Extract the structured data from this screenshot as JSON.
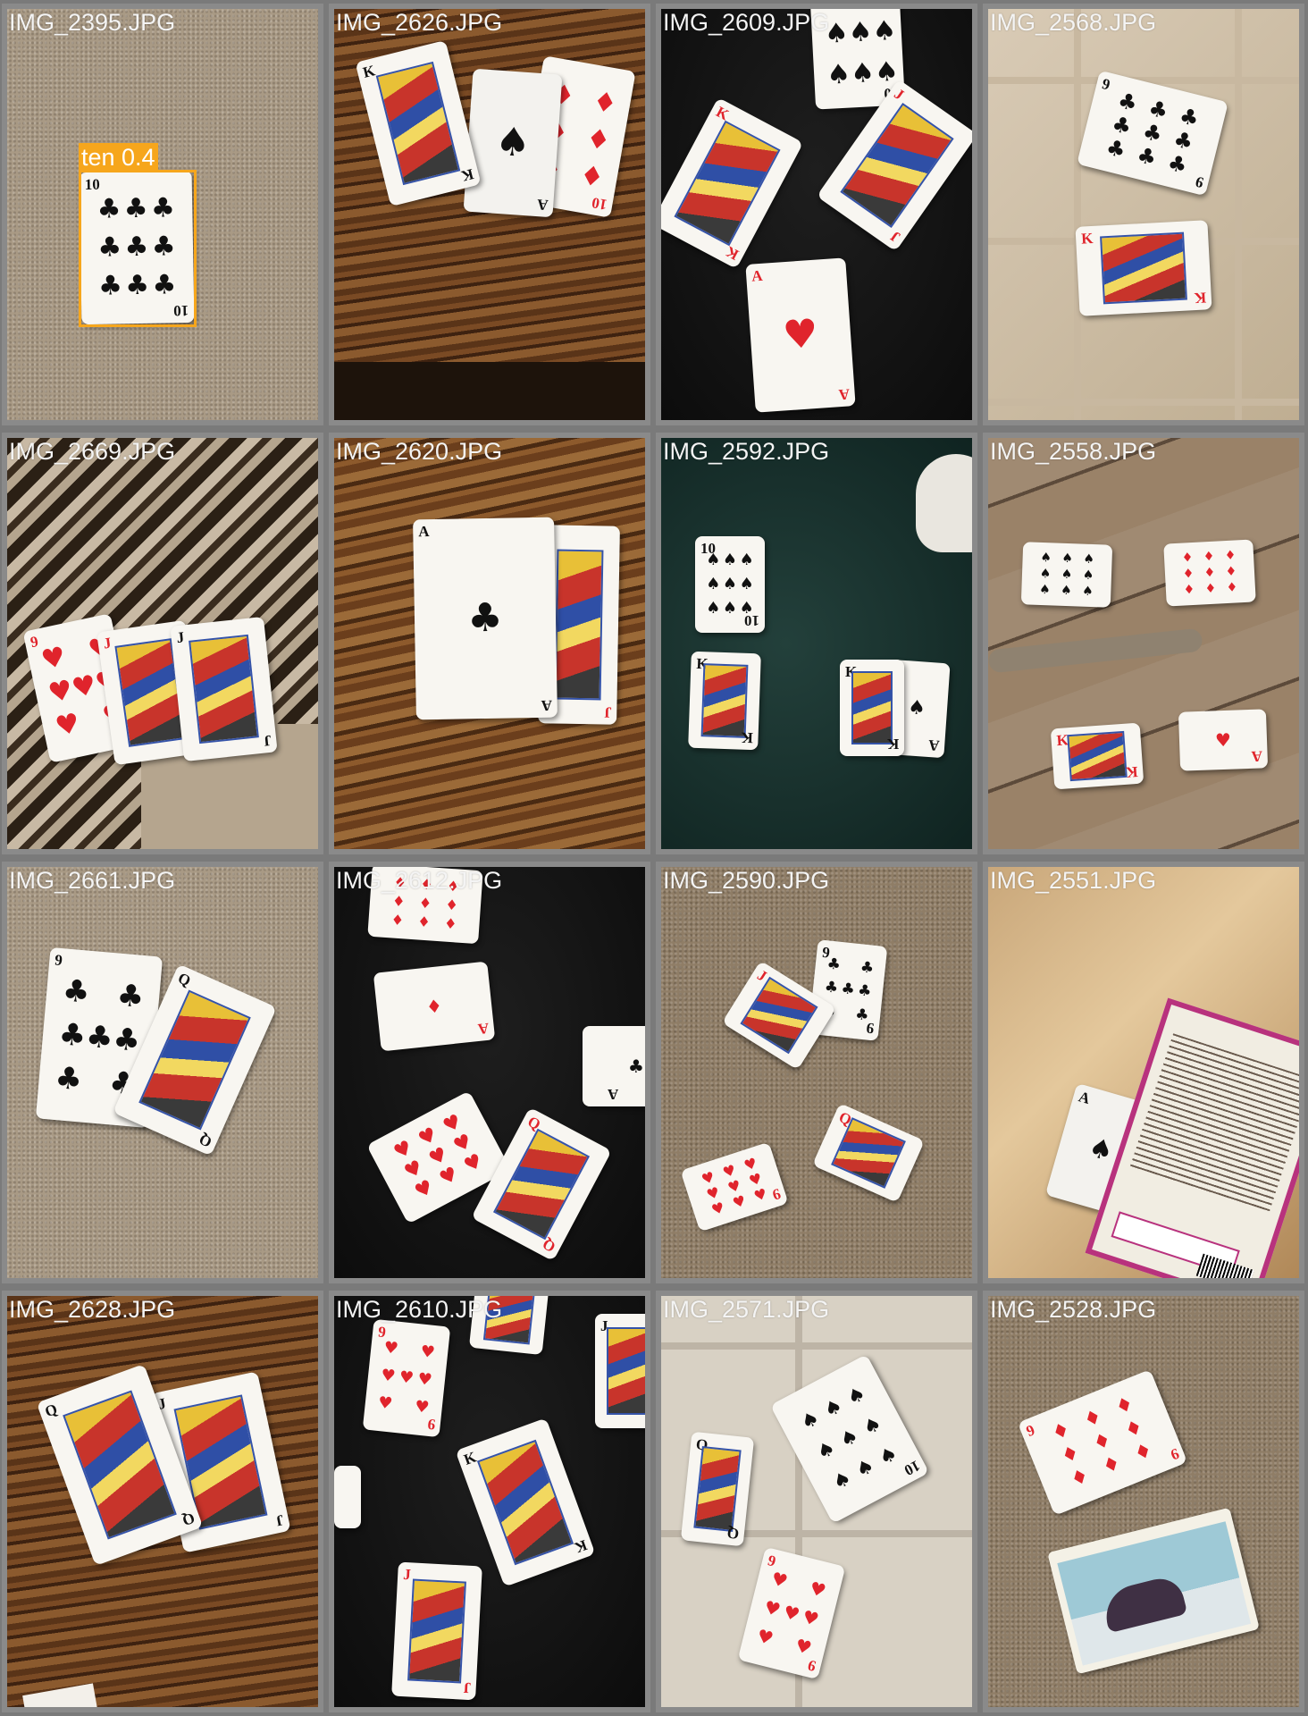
{
  "tiles": [
    {
      "filename": "IMG_2395.JPG",
      "detection": {
        "label": "ten 0.4"
      }
    },
    {
      "filename": "IMG_2626.JPG"
    },
    {
      "filename": "IMG_2609.JPG"
    },
    {
      "filename": "IMG_2568.JPG"
    },
    {
      "filename": "IMG_2669.JPG"
    },
    {
      "filename": "IMG_2620.JPG"
    },
    {
      "filename": "IMG_2592.JPG"
    },
    {
      "filename": "IMG_2558.JPG"
    },
    {
      "filename": "IMG_2661.JPG"
    },
    {
      "filename": "IMG_2612.JPG"
    },
    {
      "filename": "IMG_2590.JPG"
    },
    {
      "filename": "IMG_2551.JPG"
    },
    {
      "filename": "IMG_2628.JPG"
    },
    {
      "filename": "IMG_2610.JPG"
    },
    {
      "filename": "IMG_2571.JPG"
    },
    {
      "filename": "IMG_2528.JPG"
    }
  ],
  "colors": {
    "detection_box": "#f6a61c",
    "label_text": "#f4f4f4",
    "heart_diamond": "#e0242c",
    "club_spade": "#111111"
  }
}
